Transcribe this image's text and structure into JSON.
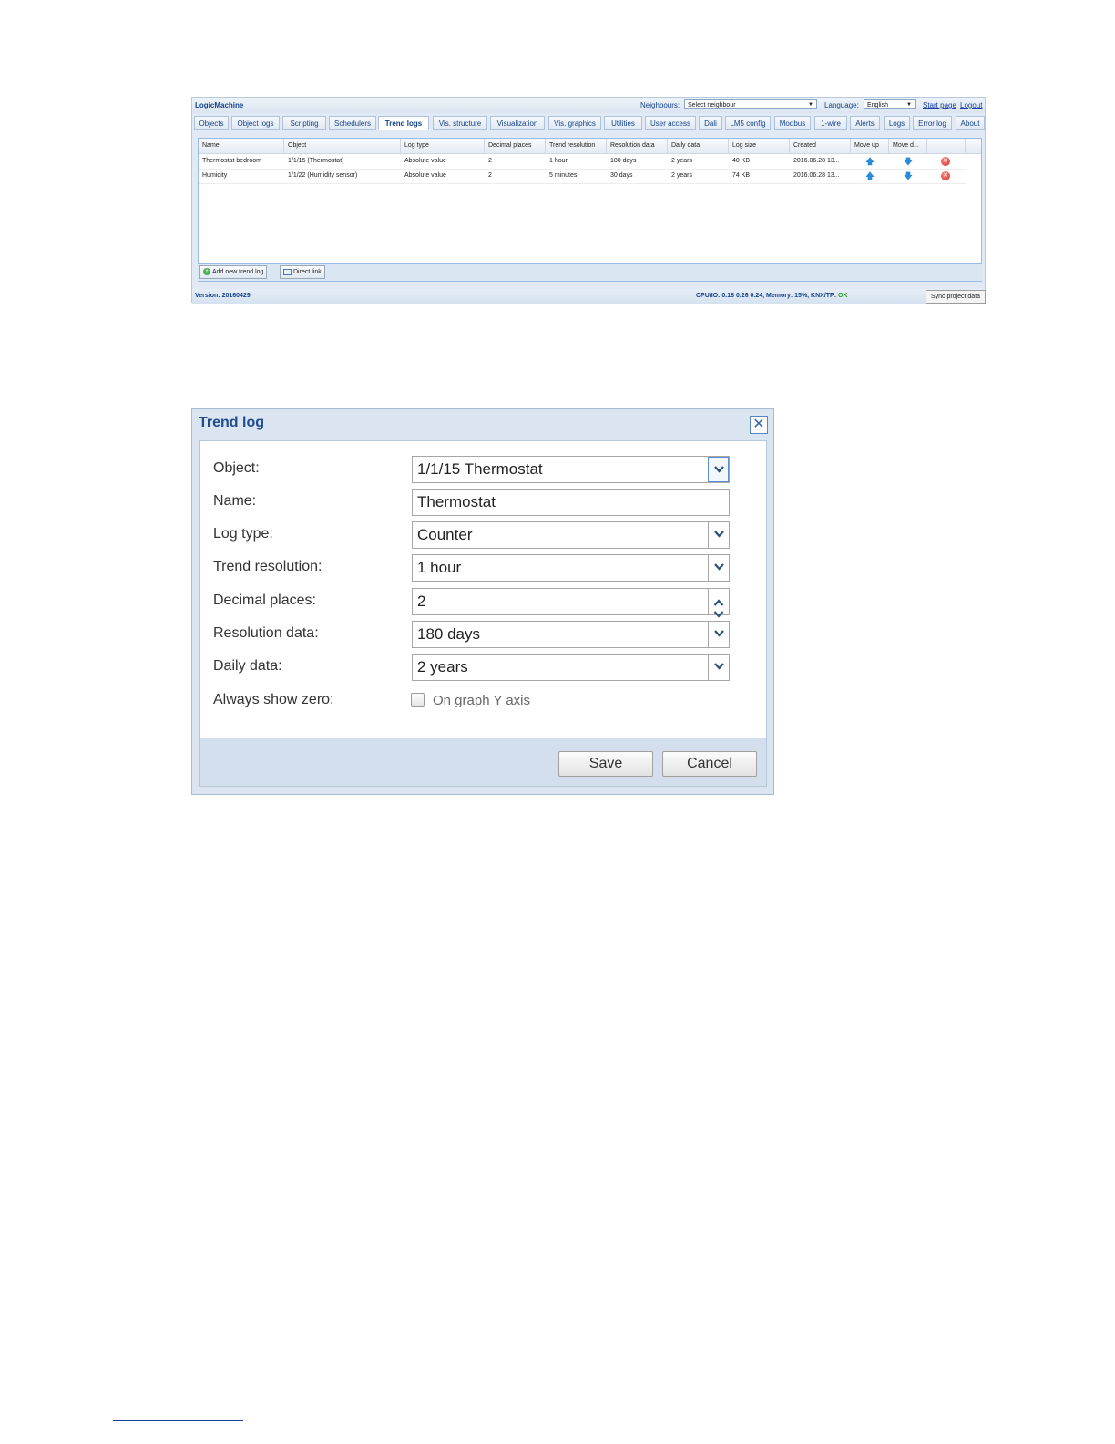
{
  "app": {
    "title": "LogicMachine",
    "neighbours_label": "Neighbours:",
    "neighbours_value": "Select neighbour",
    "language_label": "Language:",
    "language_value": "English",
    "start_page_link": "Start page",
    "logout_link": "Logout",
    "tabs": [
      {
        "label": "Objects"
      },
      {
        "label": "Object logs"
      },
      {
        "label": "Scripting"
      },
      {
        "label": "Schedulers"
      },
      {
        "label": "Trend logs"
      },
      {
        "label": "Vis. structure"
      },
      {
        "label": "Visualization"
      },
      {
        "label": "Vis. graphics"
      },
      {
        "label": "Utilities"
      },
      {
        "label": "User access"
      },
      {
        "label": "Dali"
      },
      {
        "label": "LM5 config"
      },
      {
        "label": "Modbus"
      },
      {
        "label": "1-wire"
      },
      {
        "label": "Alerts"
      },
      {
        "label": "Logs"
      },
      {
        "label": "Error log"
      },
      {
        "label": "About"
      }
    ],
    "active_tab": "Trend logs",
    "table": {
      "columns": [
        "Name",
        "Object",
        "Log type",
        "Decimal places",
        "Trend resolution",
        "Resolution data",
        "Daily data",
        "Log size",
        "Created",
        "Move up",
        "Move d..."
      ],
      "rows": [
        {
          "name": "Thermostat bedroom",
          "object": "1/1/15 (Thermostat)",
          "log_type": "Absolute value",
          "decimal_places": "2",
          "trend_resolution": "1 hour",
          "resolution_data": "180 days",
          "daily_data": "2 years",
          "log_size": "40 KB",
          "created": "2016.06.28 13..."
        },
        {
          "name": "Humidity",
          "object": "1/1/22 (Humidity sensor)",
          "log_type": "Absolute value",
          "decimal_places": "2",
          "trend_resolution": "5 minutes",
          "resolution_data": "30 days",
          "daily_data": "2 years",
          "log_size": "74 KB",
          "created": "2016.06.28 13..."
        }
      ]
    },
    "add_button": "Add new trend log",
    "direct_link_button": "Direct link",
    "version": "Version: 20160429",
    "status_prefix": "CPU/IO: 0.18 0.26 0.24, Memory: 15%, KNX/TP: ",
    "status_ok": "OK",
    "sync_button": "Sync project data"
  },
  "dialog": {
    "title": "Trend log",
    "fields": {
      "object": {
        "label": "Object:",
        "value": "1/1/15 Thermostat"
      },
      "name": {
        "label": "Name:",
        "value": "Thermostat"
      },
      "log_type": {
        "label": "Log type:",
        "value": "Counter"
      },
      "trend_resolution": {
        "label": "Trend resolution:",
        "value": "1 hour"
      },
      "decimal_places": {
        "label": "Decimal places:",
        "value": "2"
      },
      "resolution_data": {
        "label": "Resolution data:",
        "value": "180 days"
      },
      "daily_data": {
        "label": "Daily data:",
        "value": "2 years"
      },
      "always_show_zero": {
        "label": "Always show zero:",
        "checkbox_text": "On graph Y axis",
        "checked": false
      }
    },
    "save_button": "Save",
    "cancel_button": "Cancel"
  },
  "colors": {
    "accent": "#15428b",
    "status_ok": "#1f9d1f",
    "delete": "#d32f2f",
    "arrow": "#2a8bd6"
  }
}
